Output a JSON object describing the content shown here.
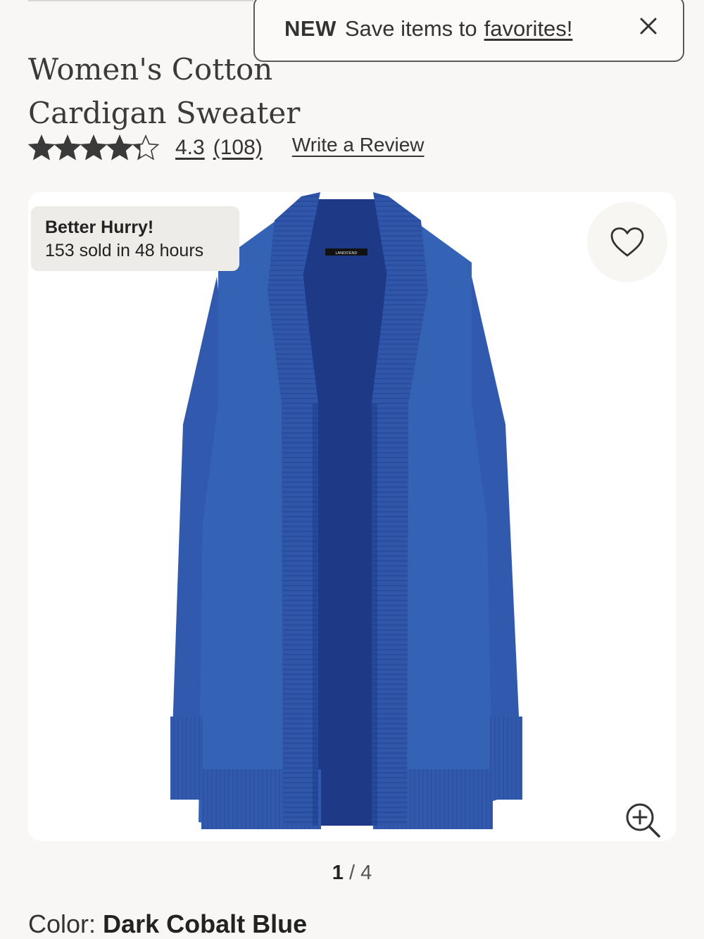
{
  "product": {
    "title_line1": "Women's Cotton",
    "title_line2": "Cardigan Sweater"
  },
  "toast": {
    "new_label": "NEW",
    "message": "Save items to",
    "link_text": "favorites!"
  },
  "rating": {
    "value": "4.3",
    "count": "(108)",
    "stars_filled": 4.3,
    "stars_total": 5,
    "write_review": "Write a Review"
  },
  "badge": {
    "headline": "Better Hurry!",
    "detail": "153 sold in 48 hours"
  },
  "gallery": {
    "current": "1",
    "separator": "/",
    "total": "4",
    "brand_tag": "LANDS'END"
  },
  "color": {
    "label": "Color:",
    "value": "Dark Cobalt Blue",
    "swatch": "#2f56a8"
  },
  "icons": {
    "close": "close-icon",
    "heart": "heart-icon",
    "zoom": "zoom-in-icon",
    "star": "star-icon"
  }
}
